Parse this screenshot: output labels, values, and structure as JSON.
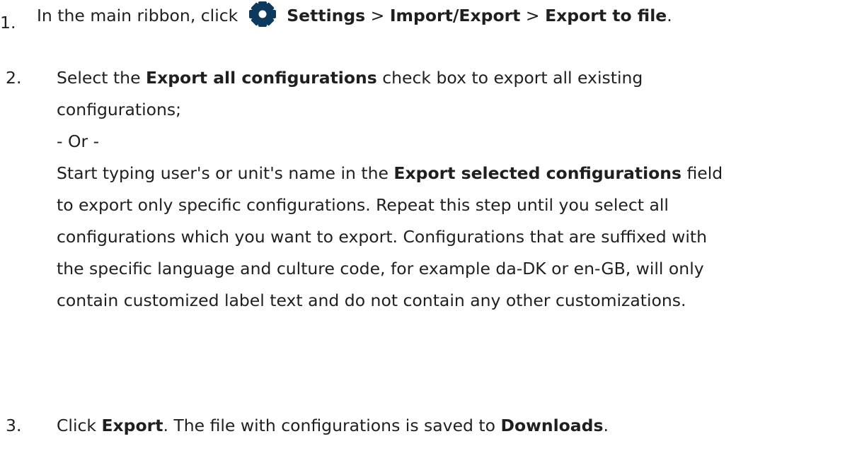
{
  "steps": [
    {
      "number": "1.",
      "text_before": "In the main ribbon, click",
      "icon": "gear-icon",
      "settings": "Settings",
      "sep1": " > ",
      "import_export": "Import/Export",
      "sep2": " > ",
      "export_to_file": "Export to file",
      "end": "."
    },
    {
      "number": "2.",
      "line1_before": "Select the ",
      "export_all": "Export all configurations",
      "line1_after": " check box to export all existing",
      "line2": "configurations;",
      "or": "- Or -",
      "line4_before": "Start typing user's or unit's name in the ",
      "export_selected": "Export selected configurations",
      "line4_after": " field",
      "line5": "to export only specific configurations. Repeat this step until you select all",
      "line6": "configurations which you want to export. Configurations that are suffixed with",
      "line7": "the specific language and culture code, for example da-DK or en-GB, will only",
      "line8": "contain customized label text and do not contain any other customizations."
    },
    {
      "number": "3.",
      "text_before": "Click ",
      "export": "Export",
      "text_middle": ". The file with configurations is saved to ",
      "downloads": "Downloads",
      "end": "."
    }
  ],
  "colors": {
    "text": "#1f1f1f",
    "gear": "#0b3a5e"
  }
}
